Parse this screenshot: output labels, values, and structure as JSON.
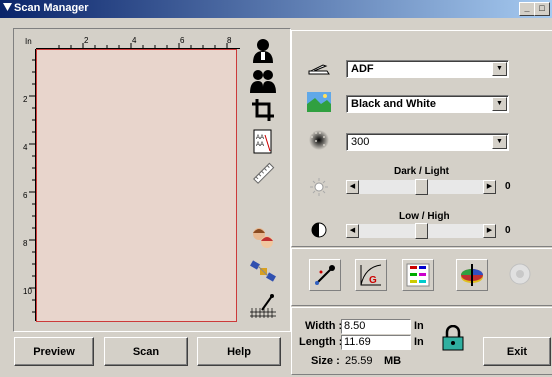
{
  "window": {
    "title": "Scan Manager",
    "minimize": "_",
    "maximize": "□",
    "close": "×"
  },
  "ruler": {
    "unit": "In",
    "top_marks": [
      "2",
      "4",
      "6",
      "8"
    ],
    "left_marks": [
      "2",
      "4",
      "6",
      "8",
      "10"
    ]
  },
  "left_tools": [
    {
      "icon": "single-person-icon"
    },
    {
      "icon": "two-people-icon"
    },
    {
      "icon": "crop-icon"
    },
    {
      "icon": "text-document-icon"
    },
    {
      "icon": "ruler-icon"
    },
    {
      "icon": "faces-color-icon"
    },
    {
      "icon": "satellite-icon"
    },
    {
      "icon": "eyedropper-grid-icon"
    }
  ],
  "settings": {
    "source": {
      "icon": "scanner-icon",
      "value": "ADF"
    },
    "mode": {
      "icon": "landscape-photo-icon",
      "value": "Black and White"
    },
    "resolution": {
      "icon": "halftone-icon",
      "value": "300"
    },
    "brightness": {
      "label": "Dark / Light",
      "value": "0",
      "icon": "sun-icon",
      "level": 0.5
    },
    "contrast": {
      "label": "Low / High",
      "value": "0",
      "icon": "contrast-icon",
      "level": 0.5
    }
  },
  "action_icons": [
    "color-picker-icon",
    "gamma-curve-icon",
    "color-balance-icon",
    "color-wheel-icon",
    "disabled-disc-icon"
  ],
  "dimensions": {
    "width_label": "Width :",
    "width_value": "8.50",
    "width_unit": "In",
    "length_label": "Length :",
    "length_value": "11.69",
    "length_unit": "In",
    "size_label": "Size :",
    "size_value": "25.59",
    "size_unit": "MB"
  },
  "buttons": {
    "preview": "Preview",
    "scan": "Scan",
    "help": "Help",
    "exit": "Exit"
  },
  "colors": {
    "title_start": "#0a246a",
    "title_end": "#a6caf0",
    "preview_bg": "#e8d5cc",
    "preview_border": "#cc3a3a"
  }
}
